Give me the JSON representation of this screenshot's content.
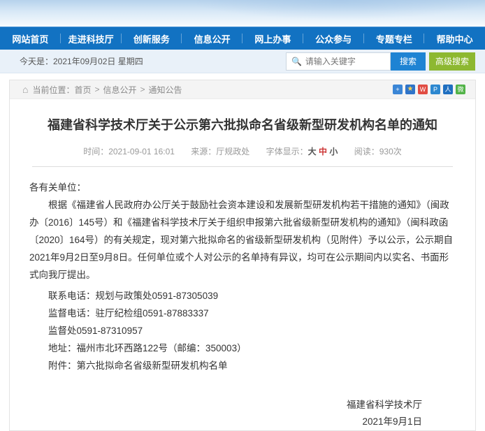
{
  "colors": {
    "nav_blue": "#1272c2",
    "search_button_blue": "#1e83d3",
    "advanced_search_green": "#8db831",
    "font_medium_red": "#cc3333",
    "weibo_red": "#e14d43",
    "wechat_green": "#52b348"
  },
  "nav": {
    "items": [
      {
        "label": "网站首页"
      },
      {
        "label": "走进科技厅"
      },
      {
        "label": "创新服务"
      },
      {
        "label": "信息公开"
      },
      {
        "label": "网上办事"
      },
      {
        "label": "公众参与"
      },
      {
        "label": "专题专栏"
      },
      {
        "label": "帮助中心"
      }
    ]
  },
  "datebar": {
    "today": "今天是：2021年09月02日 星期四",
    "search_placeholder": "请输入关键字",
    "search_icon": "🔍",
    "search_button": "搜索",
    "advanced_search_button": "高级搜索"
  },
  "breadcrumb": {
    "home_icon": "⌂",
    "prefix": "当前位置：",
    "separator": ">",
    "items": [
      {
        "label": "首页"
      },
      {
        "label": "信息公开"
      },
      {
        "label": "通知公告"
      }
    ]
  },
  "share": {
    "icons": [
      {
        "name": "share-add",
        "glyph": "+"
      },
      {
        "name": "share-favorite",
        "glyph": "★"
      },
      {
        "name": "share-weibo",
        "glyph": "W"
      },
      {
        "name": "share-qq",
        "glyph": "P"
      },
      {
        "name": "share-people",
        "glyph": "人"
      },
      {
        "name": "share-wechat",
        "glyph": "微"
      }
    ]
  },
  "article": {
    "title": "福建省科学技术厅关于公示第六批拟命名省级新型研发机构名单的通知",
    "meta": {
      "time": "时间：2021-09-01 16:01",
      "source": "来源：厅规政处",
      "font_label": "字体显示：",
      "font_large": "大",
      "font_medium": "中",
      "font_small": "小",
      "views": "阅读：930次"
    },
    "salutation": "各有关单位：",
    "body": "根据《福建省人民政府办公厅关于鼓励社会资本建设和发展新型研发机构若干措施的通知》（闽政办〔2016〕145号）和《福建省科学技术厅关于组织申报第六批省级新型研发机构的通知》（闽科政函〔2020〕164号）的有关规定，现对第六批拟命名的省级新型研发机构（见附件）予以公示，公示期自2021年9月2日至9月8日。任何单位或个人对公示的名单持有异议，均可在公示期间内以实名、书面形式向我厅提出。",
    "contact_phone": "联系电话：规划与政策处0591-87305039",
    "supervision_phone": "监督电话：驻厅纪检组0591-87883337",
    "supervision_office": "监督处0591-87310957",
    "address": "地址：福州市北环西路122号（邮编：350003）",
    "attachment": "附件：第六批拟命名省级新型研发机构名单",
    "signer": "福建省科学技术厅",
    "sign_date": "2021年9月1日"
  }
}
